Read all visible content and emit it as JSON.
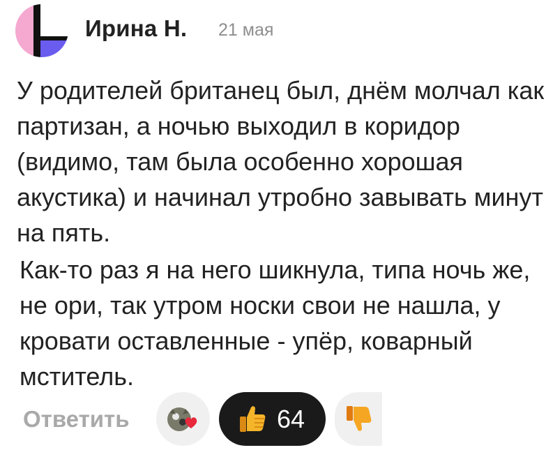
{
  "author": {
    "name": "Ирина Н.",
    "date": "21 мая"
  },
  "comment": {
    "paragraphs": [
      "У родителей британец был, днём молчал как партизан, а ночью выходил в коридор (видимо, там была особенно хорошая акустика) и начинал утробно завывать минут на пять.",
      "Как-то раз я на него шикнула, типа ночь же, не ори, так утром носки свои не нашла, у кровати оставленные - упёр, коварный мститель."
    ]
  },
  "actions": {
    "reply_label": "Ответить",
    "reactions": {
      "other_icon": "cat-heart-reaction-icon",
      "like_icon": "thumbs-up-icon",
      "like_count": "64",
      "dislike_icon": "thumbs-down-icon"
    }
  },
  "colors": {
    "text": "#222222",
    "muted": "#8e8e8e",
    "reply": "#a9a9a9",
    "reaction_bg": "#f0f0f0",
    "active_reaction_bg": "#1a1a1a",
    "avatar_pink": "#f5a9d0",
    "avatar_purple": "#6b5cf0"
  }
}
